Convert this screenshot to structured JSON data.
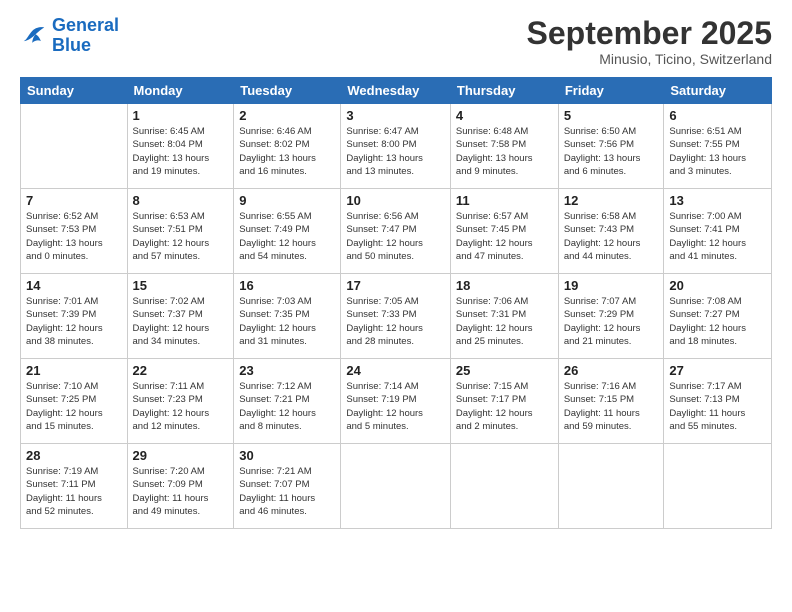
{
  "logo": {
    "line1": "General",
    "line2": "Blue"
  },
  "header": {
    "month": "September 2025",
    "location": "Minusio, Ticino, Switzerland"
  },
  "weekdays": [
    "Sunday",
    "Monday",
    "Tuesday",
    "Wednesday",
    "Thursday",
    "Friday",
    "Saturday"
  ],
  "weeks": [
    [
      {
        "day": "",
        "info": ""
      },
      {
        "day": "1",
        "info": "Sunrise: 6:45 AM\nSunset: 8:04 PM\nDaylight: 13 hours\nand 19 minutes."
      },
      {
        "day": "2",
        "info": "Sunrise: 6:46 AM\nSunset: 8:02 PM\nDaylight: 13 hours\nand 16 minutes."
      },
      {
        "day": "3",
        "info": "Sunrise: 6:47 AM\nSunset: 8:00 PM\nDaylight: 13 hours\nand 13 minutes."
      },
      {
        "day": "4",
        "info": "Sunrise: 6:48 AM\nSunset: 7:58 PM\nDaylight: 13 hours\nand 9 minutes."
      },
      {
        "day": "5",
        "info": "Sunrise: 6:50 AM\nSunset: 7:56 PM\nDaylight: 13 hours\nand 6 minutes."
      },
      {
        "day": "6",
        "info": "Sunrise: 6:51 AM\nSunset: 7:55 PM\nDaylight: 13 hours\nand 3 minutes."
      }
    ],
    [
      {
        "day": "7",
        "info": "Sunrise: 6:52 AM\nSunset: 7:53 PM\nDaylight: 13 hours\nand 0 minutes."
      },
      {
        "day": "8",
        "info": "Sunrise: 6:53 AM\nSunset: 7:51 PM\nDaylight: 12 hours\nand 57 minutes."
      },
      {
        "day": "9",
        "info": "Sunrise: 6:55 AM\nSunset: 7:49 PM\nDaylight: 12 hours\nand 54 minutes."
      },
      {
        "day": "10",
        "info": "Sunrise: 6:56 AM\nSunset: 7:47 PM\nDaylight: 12 hours\nand 50 minutes."
      },
      {
        "day": "11",
        "info": "Sunrise: 6:57 AM\nSunset: 7:45 PM\nDaylight: 12 hours\nand 47 minutes."
      },
      {
        "day": "12",
        "info": "Sunrise: 6:58 AM\nSunset: 7:43 PM\nDaylight: 12 hours\nand 44 minutes."
      },
      {
        "day": "13",
        "info": "Sunrise: 7:00 AM\nSunset: 7:41 PM\nDaylight: 12 hours\nand 41 minutes."
      }
    ],
    [
      {
        "day": "14",
        "info": "Sunrise: 7:01 AM\nSunset: 7:39 PM\nDaylight: 12 hours\nand 38 minutes."
      },
      {
        "day": "15",
        "info": "Sunrise: 7:02 AM\nSunset: 7:37 PM\nDaylight: 12 hours\nand 34 minutes."
      },
      {
        "day": "16",
        "info": "Sunrise: 7:03 AM\nSunset: 7:35 PM\nDaylight: 12 hours\nand 31 minutes."
      },
      {
        "day": "17",
        "info": "Sunrise: 7:05 AM\nSunset: 7:33 PM\nDaylight: 12 hours\nand 28 minutes."
      },
      {
        "day": "18",
        "info": "Sunrise: 7:06 AM\nSunset: 7:31 PM\nDaylight: 12 hours\nand 25 minutes."
      },
      {
        "day": "19",
        "info": "Sunrise: 7:07 AM\nSunset: 7:29 PM\nDaylight: 12 hours\nand 21 minutes."
      },
      {
        "day": "20",
        "info": "Sunrise: 7:08 AM\nSunset: 7:27 PM\nDaylight: 12 hours\nand 18 minutes."
      }
    ],
    [
      {
        "day": "21",
        "info": "Sunrise: 7:10 AM\nSunset: 7:25 PM\nDaylight: 12 hours\nand 15 minutes."
      },
      {
        "day": "22",
        "info": "Sunrise: 7:11 AM\nSunset: 7:23 PM\nDaylight: 12 hours\nand 12 minutes."
      },
      {
        "day": "23",
        "info": "Sunrise: 7:12 AM\nSunset: 7:21 PM\nDaylight: 12 hours\nand 8 minutes."
      },
      {
        "day": "24",
        "info": "Sunrise: 7:14 AM\nSunset: 7:19 PM\nDaylight: 12 hours\nand 5 minutes."
      },
      {
        "day": "25",
        "info": "Sunrise: 7:15 AM\nSunset: 7:17 PM\nDaylight: 12 hours\nand 2 minutes."
      },
      {
        "day": "26",
        "info": "Sunrise: 7:16 AM\nSunset: 7:15 PM\nDaylight: 11 hours\nand 59 minutes."
      },
      {
        "day": "27",
        "info": "Sunrise: 7:17 AM\nSunset: 7:13 PM\nDaylight: 11 hours\nand 55 minutes."
      }
    ],
    [
      {
        "day": "28",
        "info": "Sunrise: 7:19 AM\nSunset: 7:11 PM\nDaylight: 11 hours\nand 52 minutes."
      },
      {
        "day": "29",
        "info": "Sunrise: 7:20 AM\nSunset: 7:09 PM\nDaylight: 11 hours\nand 49 minutes."
      },
      {
        "day": "30",
        "info": "Sunrise: 7:21 AM\nSunset: 7:07 PM\nDaylight: 11 hours\nand 46 minutes."
      },
      {
        "day": "",
        "info": ""
      },
      {
        "day": "",
        "info": ""
      },
      {
        "day": "",
        "info": ""
      },
      {
        "day": "",
        "info": ""
      }
    ]
  ]
}
